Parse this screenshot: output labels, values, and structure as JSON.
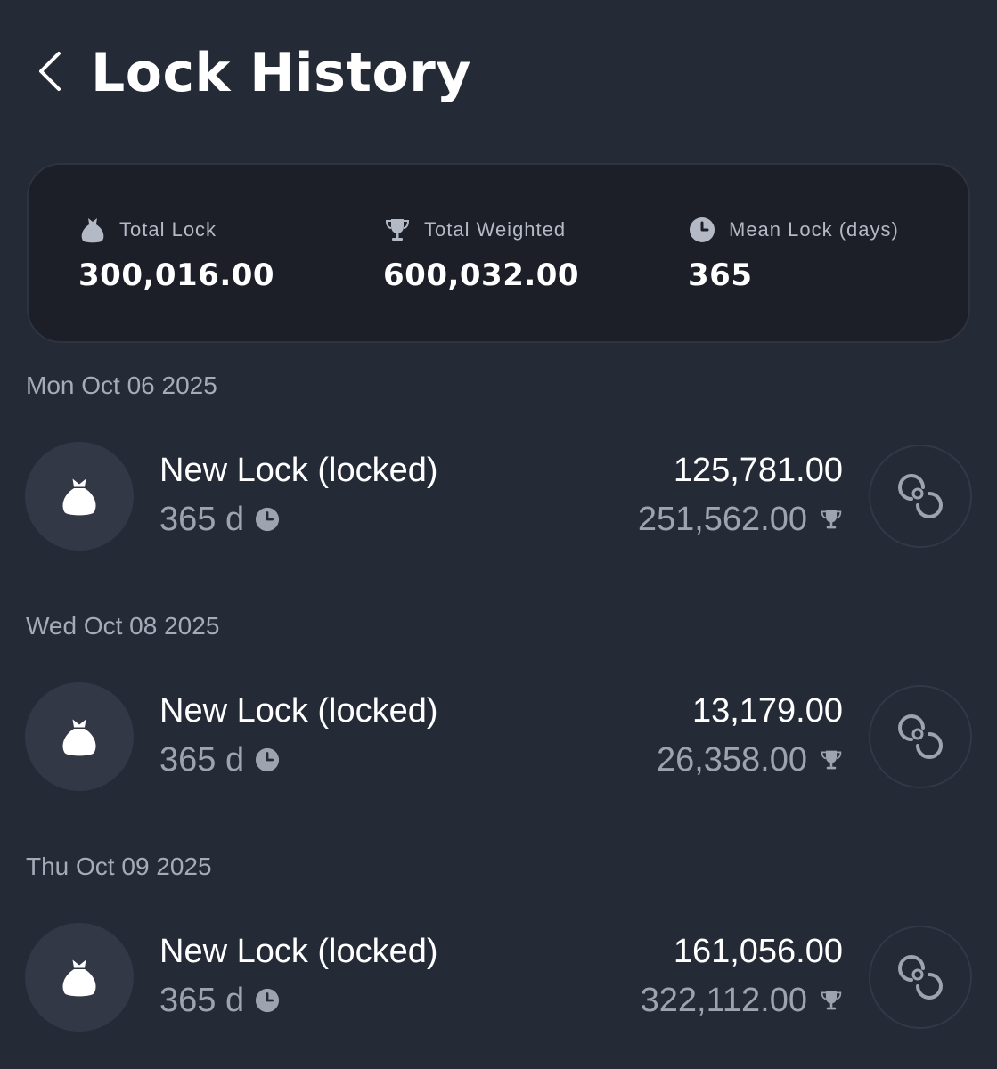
{
  "header": {
    "title": "Lock History"
  },
  "summary": {
    "total_lock": {
      "label": "Total Lock",
      "value": "300,016.00",
      "icon": "money-bag-icon"
    },
    "total_weighted": {
      "label": "Total Weighted",
      "value": "600,032.00",
      "icon": "trophy-icon"
    },
    "mean_lock": {
      "label": "Mean Lock (days)",
      "value": "365",
      "icon": "clock-icon"
    }
  },
  "groups": [
    {
      "date": "Mon Oct 06 2025",
      "items": [
        {
          "title": "New Lock (locked)",
          "duration": "365 d",
          "amount": "125,781.00",
          "weighted": "251,562.00"
        }
      ]
    },
    {
      "date": "Wed Oct 08 2025",
      "items": [
        {
          "title": "New Lock (locked)",
          "duration": "365 d",
          "amount": "13,179.00",
          "weighted": "26,358.00"
        }
      ]
    },
    {
      "date": "Thu Oct 09 2025",
      "items": [
        {
          "title": "New Lock (locked)",
          "duration": "365 d",
          "amount": "161,056.00",
          "weighted": "322,112.00"
        }
      ]
    }
  ],
  "colors": {
    "background": "#252a37",
    "card": "#1c1f28",
    "icon_circle": "#323846",
    "text_primary": "#ffffff",
    "text_secondary": "#9ea3b0"
  }
}
